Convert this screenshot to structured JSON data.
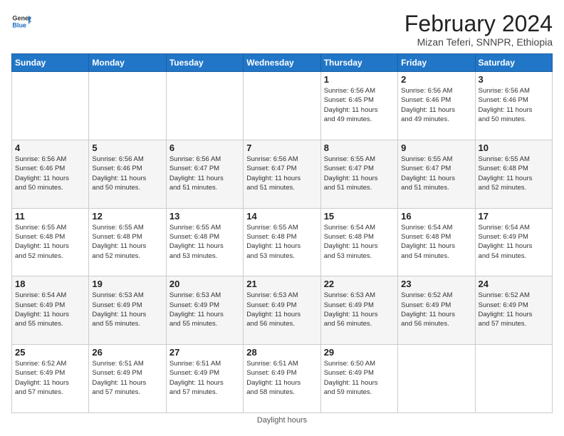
{
  "header": {
    "logo_general": "General",
    "logo_blue": "Blue",
    "month_title": "February 2024",
    "location": "Mizan Teferi, SNNPR, Ethiopia"
  },
  "days_of_week": [
    "Sunday",
    "Monday",
    "Tuesday",
    "Wednesday",
    "Thursday",
    "Friday",
    "Saturday"
  ],
  "weeks": [
    [
      {
        "num": "",
        "info": ""
      },
      {
        "num": "",
        "info": ""
      },
      {
        "num": "",
        "info": ""
      },
      {
        "num": "",
        "info": ""
      },
      {
        "num": "1",
        "info": "Sunrise: 6:56 AM\nSunset: 6:45 PM\nDaylight: 11 hours\nand 49 minutes."
      },
      {
        "num": "2",
        "info": "Sunrise: 6:56 AM\nSunset: 6:46 PM\nDaylight: 11 hours\nand 49 minutes."
      },
      {
        "num": "3",
        "info": "Sunrise: 6:56 AM\nSunset: 6:46 PM\nDaylight: 11 hours\nand 50 minutes."
      }
    ],
    [
      {
        "num": "4",
        "info": "Sunrise: 6:56 AM\nSunset: 6:46 PM\nDaylight: 11 hours\nand 50 minutes."
      },
      {
        "num": "5",
        "info": "Sunrise: 6:56 AM\nSunset: 6:46 PM\nDaylight: 11 hours\nand 50 minutes."
      },
      {
        "num": "6",
        "info": "Sunrise: 6:56 AM\nSunset: 6:47 PM\nDaylight: 11 hours\nand 51 minutes."
      },
      {
        "num": "7",
        "info": "Sunrise: 6:56 AM\nSunset: 6:47 PM\nDaylight: 11 hours\nand 51 minutes."
      },
      {
        "num": "8",
        "info": "Sunrise: 6:55 AM\nSunset: 6:47 PM\nDaylight: 11 hours\nand 51 minutes."
      },
      {
        "num": "9",
        "info": "Sunrise: 6:55 AM\nSunset: 6:47 PM\nDaylight: 11 hours\nand 51 minutes."
      },
      {
        "num": "10",
        "info": "Sunrise: 6:55 AM\nSunset: 6:48 PM\nDaylight: 11 hours\nand 52 minutes."
      }
    ],
    [
      {
        "num": "11",
        "info": "Sunrise: 6:55 AM\nSunset: 6:48 PM\nDaylight: 11 hours\nand 52 minutes."
      },
      {
        "num": "12",
        "info": "Sunrise: 6:55 AM\nSunset: 6:48 PM\nDaylight: 11 hours\nand 52 minutes."
      },
      {
        "num": "13",
        "info": "Sunrise: 6:55 AM\nSunset: 6:48 PM\nDaylight: 11 hours\nand 53 minutes."
      },
      {
        "num": "14",
        "info": "Sunrise: 6:55 AM\nSunset: 6:48 PM\nDaylight: 11 hours\nand 53 minutes."
      },
      {
        "num": "15",
        "info": "Sunrise: 6:54 AM\nSunset: 6:48 PM\nDaylight: 11 hours\nand 53 minutes."
      },
      {
        "num": "16",
        "info": "Sunrise: 6:54 AM\nSunset: 6:48 PM\nDaylight: 11 hours\nand 54 minutes."
      },
      {
        "num": "17",
        "info": "Sunrise: 6:54 AM\nSunset: 6:49 PM\nDaylight: 11 hours\nand 54 minutes."
      }
    ],
    [
      {
        "num": "18",
        "info": "Sunrise: 6:54 AM\nSunset: 6:49 PM\nDaylight: 11 hours\nand 55 minutes."
      },
      {
        "num": "19",
        "info": "Sunrise: 6:53 AM\nSunset: 6:49 PM\nDaylight: 11 hours\nand 55 minutes."
      },
      {
        "num": "20",
        "info": "Sunrise: 6:53 AM\nSunset: 6:49 PM\nDaylight: 11 hours\nand 55 minutes."
      },
      {
        "num": "21",
        "info": "Sunrise: 6:53 AM\nSunset: 6:49 PM\nDaylight: 11 hours\nand 56 minutes."
      },
      {
        "num": "22",
        "info": "Sunrise: 6:53 AM\nSunset: 6:49 PM\nDaylight: 11 hours\nand 56 minutes."
      },
      {
        "num": "23",
        "info": "Sunrise: 6:52 AM\nSunset: 6:49 PM\nDaylight: 11 hours\nand 56 minutes."
      },
      {
        "num": "24",
        "info": "Sunrise: 6:52 AM\nSunset: 6:49 PM\nDaylight: 11 hours\nand 57 minutes."
      }
    ],
    [
      {
        "num": "25",
        "info": "Sunrise: 6:52 AM\nSunset: 6:49 PM\nDaylight: 11 hours\nand 57 minutes."
      },
      {
        "num": "26",
        "info": "Sunrise: 6:51 AM\nSunset: 6:49 PM\nDaylight: 11 hours\nand 57 minutes."
      },
      {
        "num": "27",
        "info": "Sunrise: 6:51 AM\nSunset: 6:49 PM\nDaylight: 11 hours\nand 57 minutes."
      },
      {
        "num": "28",
        "info": "Sunrise: 6:51 AM\nSunset: 6:49 PM\nDaylight: 11 hours\nand 58 minutes."
      },
      {
        "num": "29",
        "info": "Sunrise: 6:50 AM\nSunset: 6:49 PM\nDaylight: 11 hours\nand 59 minutes."
      },
      {
        "num": "",
        "info": ""
      },
      {
        "num": "",
        "info": ""
      }
    ]
  ],
  "footer": {
    "note": "Daylight hours"
  }
}
